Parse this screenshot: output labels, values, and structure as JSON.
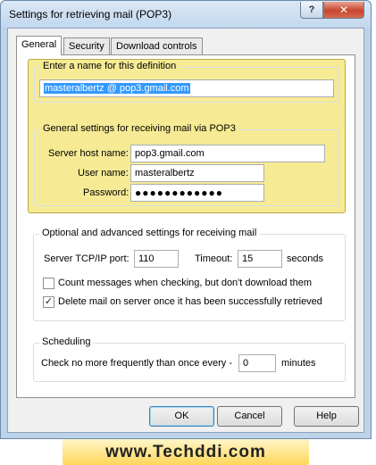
{
  "window": {
    "title": "Settings for retrieving mail (POP3)",
    "help_label": "?",
    "close_label": "✕"
  },
  "tabs": [
    {
      "label": "General",
      "active": true
    },
    {
      "label": "Security",
      "active": false
    },
    {
      "label": "Download controls",
      "active": false
    }
  ],
  "definition": {
    "title": "Enter a name for this definition",
    "name_value": "masteralbertz @ pop3.gmail.com"
  },
  "general": {
    "title": "General settings for receiving mail via POP3",
    "server_label": "Server host name:",
    "server_value": "pop3.gmail.com",
    "user_label": "User name:",
    "user_value": "masteralbertz",
    "password_label": "Password:",
    "password_value": "●●●●●●●●●●●●"
  },
  "advanced": {
    "title": "Optional and advanced settings for receiving mail",
    "port_label": "Server TCP/IP port:",
    "port_value": "110",
    "timeout_label": "Timeout:",
    "timeout_value": "15",
    "timeout_unit": "seconds",
    "count_only_label": "Count messages when checking, but don't download them",
    "count_only_checked": false,
    "delete_label": "Delete mail on server once it has been successfully retrieved",
    "delete_checked": true,
    "check_mark": "✓"
  },
  "scheduling": {
    "title": "Scheduling",
    "check_label": "Check no more frequently than once every -",
    "check_value": "0",
    "check_unit": "minutes"
  },
  "buttons": {
    "ok": "OK",
    "cancel": "Cancel",
    "help": "Help"
  },
  "watermark": "www.Techddi.com",
  "colors": {
    "highlight_panel": "#f6eb94",
    "selection": "#3399ff",
    "close_button": "#c8452d"
  }
}
